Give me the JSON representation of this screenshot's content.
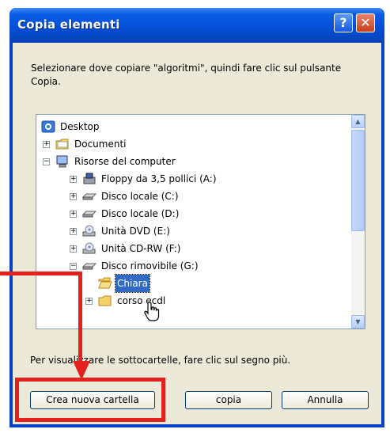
{
  "window": {
    "title": "Copia elementi"
  },
  "titlebar_buttons": {
    "help": "?",
    "close": "✕"
  },
  "prompt": "Selezionare dove copiare \"algoritmi\", quindi fare clic sul pulsante Copia.",
  "tree": {
    "items": [
      {
        "label": "Desktop",
        "icon": "desktop-icon",
        "level": 0,
        "expander": ""
      },
      {
        "label": "Documenti",
        "icon": "folder-icon",
        "level": 1,
        "expander": "+"
      },
      {
        "label": "Risorse del computer",
        "icon": "computer-icon",
        "level": 1,
        "expander": "−"
      },
      {
        "label": "Floppy da 3,5 pollici (A:)",
        "icon": "floppy-icon",
        "level": 2,
        "expander": "+"
      },
      {
        "label": "Disco locale (C:)",
        "icon": "drive-icon",
        "level": 2,
        "expander": "+"
      },
      {
        "label": "Disco locale (D:)",
        "icon": "drive-icon",
        "level": 2,
        "expander": "+"
      },
      {
        "label": "Unità DVD (E:)",
        "icon": "cd-icon",
        "level": 2,
        "expander": "+"
      },
      {
        "label": "Unità CD-RW (F:)",
        "icon": "cd-icon",
        "level": 2,
        "expander": "+"
      },
      {
        "label": "Disco rimovibile (G:)",
        "icon": "drive-icon",
        "level": 2,
        "expander": "−"
      },
      {
        "label": "Chiara",
        "icon": "folder-open-icon",
        "level": 3,
        "expander": "",
        "selected": true
      },
      {
        "label": "corso ecdl",
        "icon": "folder-icon",
        "level": 3,
        "expander": "+"
      }
    ]
  },
  "hint": "Per visualizzare le sottocartelle, fare clic sul segno più.",
  "buttons": {
    "new_folder": "Crea nuova cartella",
    "copy": "copia",
    "cancel": "Annulla"
  },
  "colors": {
    "highlight": "#e5211d",
    "selection": "#316ac5",
    "titlebar": "#0550d7"
  }
}
